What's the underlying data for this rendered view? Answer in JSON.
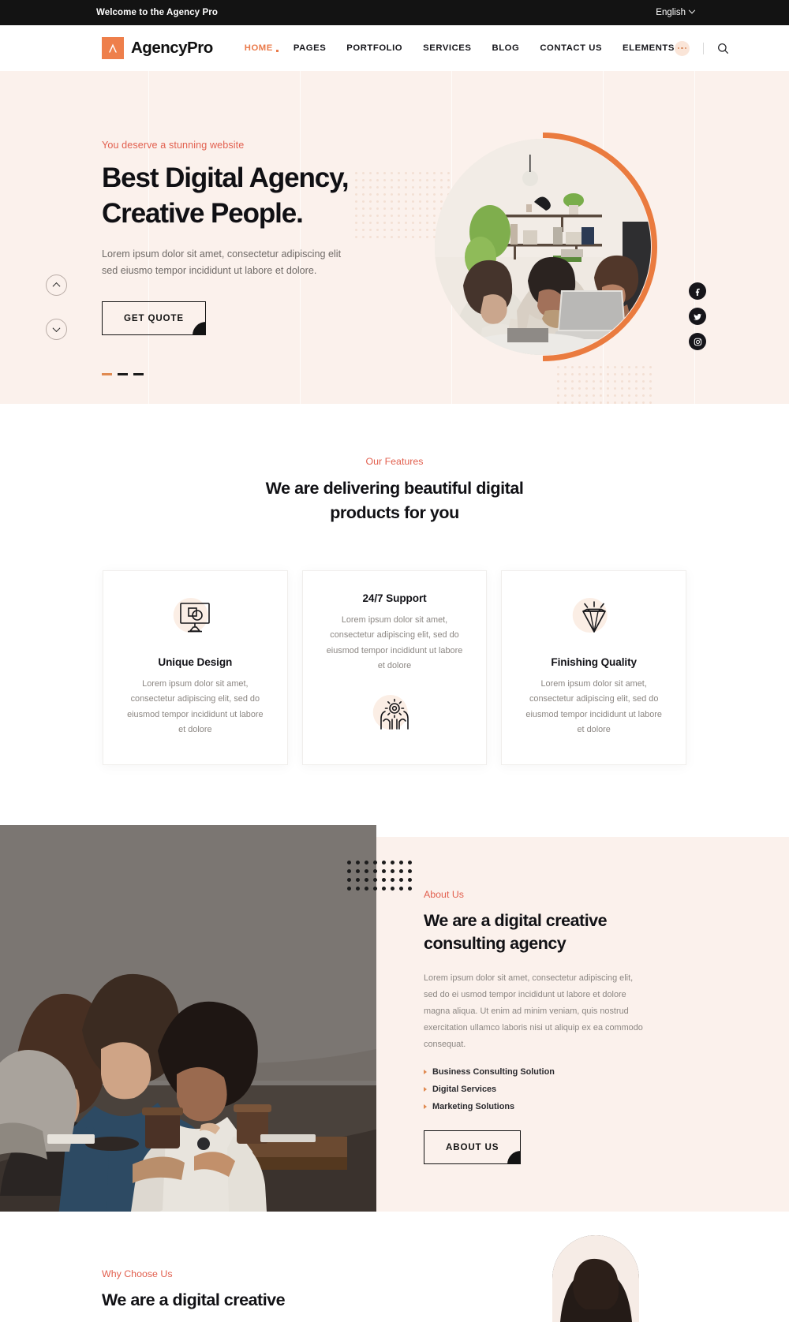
{
  "topbar": {
    "welcome": "Welcome to the Agency Pro",
    "language": "English"
  },
  "header": {
    "logo_text": "AgencyPro",
    "nav": [
      {
        "label": "HOME",
        "active": true
      },
      {
        "label": "PAGES",
        "active": false
      },
      {
        "label": "PORTFOLIO",
        "active": false
      },
      {
        "label": "SERVICES",
        "active": false
      },
      {
        "label": "BLOG",
        "active": false
      },
      {
        "label": "CONTACT US",
        "active": false
      },
      {
        "label": "ELEMENTS",
        "active": false
      }
    ],
    "more_icon": "ellipsis-icon",
    "search_icon": "search-icon"
  },
  "hero": {
    "eyebrow": "You deserve a stunning website",
    "title_line1": "Best Digital Agency,",
    "title_line2": "Creative People.",
    "description": "Lorem ipsum dolor sit amet, consectetur adipiscing elit sed eiusmo tempor incididunt ut labore et dolore.",
    "cta_label": "GET QUOTE",
    "slide_total": 3,
    "slide_active": 1,
    "prev_icon": "chevron-up-icon",
    "next_icon": "chevron-down-icon",
    "social": [
      {
        "name": "facebook-icon",
        "label": "Facebook"
      },
      {
        "name": "twitter-icon",
        "label": "Twitter"
      },
      {
        "name": "instagram-icon",
        "label": "Instagram"
      }
    ]
  },
  "features": {
    "eyebrow": "Our Features",
    "title": "We are delivering beautiful digital products for you",
    "cards": [
      {
        "icon": "monitor-design-icon",
        "title": "Unique Design",
        "text": "Lorem ipsum dolor sit amet, consectetur adipiscing elit, sed do eiusmod tempor incididunt ut labore et dolore",
        "icon_position": "top"
      },
      {
        "icon": "hands-gear-icon",
        "title": "24/7 Support",
        "text": "Lorem ipsum dolor sit amet, consectetur adipiscing elit, sed do eiusmod tempor incididunt ut labore et dolore",
        "icon_position": "bottom"
      },
      {
        "icon": "diamond-icon",
        "title": "Finishing Quality",
        "text": "Lorem ipsum dolor sit amet, consectetur adipiscing elit, sed do eiusmod tempor incididunt ut labore et dolore",
        "icon_position": "top"
      }
    ]
  },
  "about": {
    "eyebrow": "About Us",
    "title_line1": "We are a digital creative",
    "title_line2": "consulting agency",
    "description": "Lorem ipsum dolor sit amet, consectetur adipiscing elit, sed do ei usmod tempor incididunt ut labore et dolore magna aliqua. Ut enim ad minim veniam, quis nostrud exercitation ullamco laboris nisi ut aliquip ex ea commodo consequat.",
    "list": [
      "Business Consulting Solution",
      "Digital Services",
      "Marketing Solutions"
    ],
    "cta_label": "ABOUT US"
  },
  "why": {
    "eyebrow": "Why Choose Us",
    "title": "We are a digital creative"
  },
  "colors": {
    "accent_orange": "#ea7b3f",
    "accent_red": "#e2604f",
    "dark": "#131313",
    "hero_bg": "#fbf1ec"
  }
}
